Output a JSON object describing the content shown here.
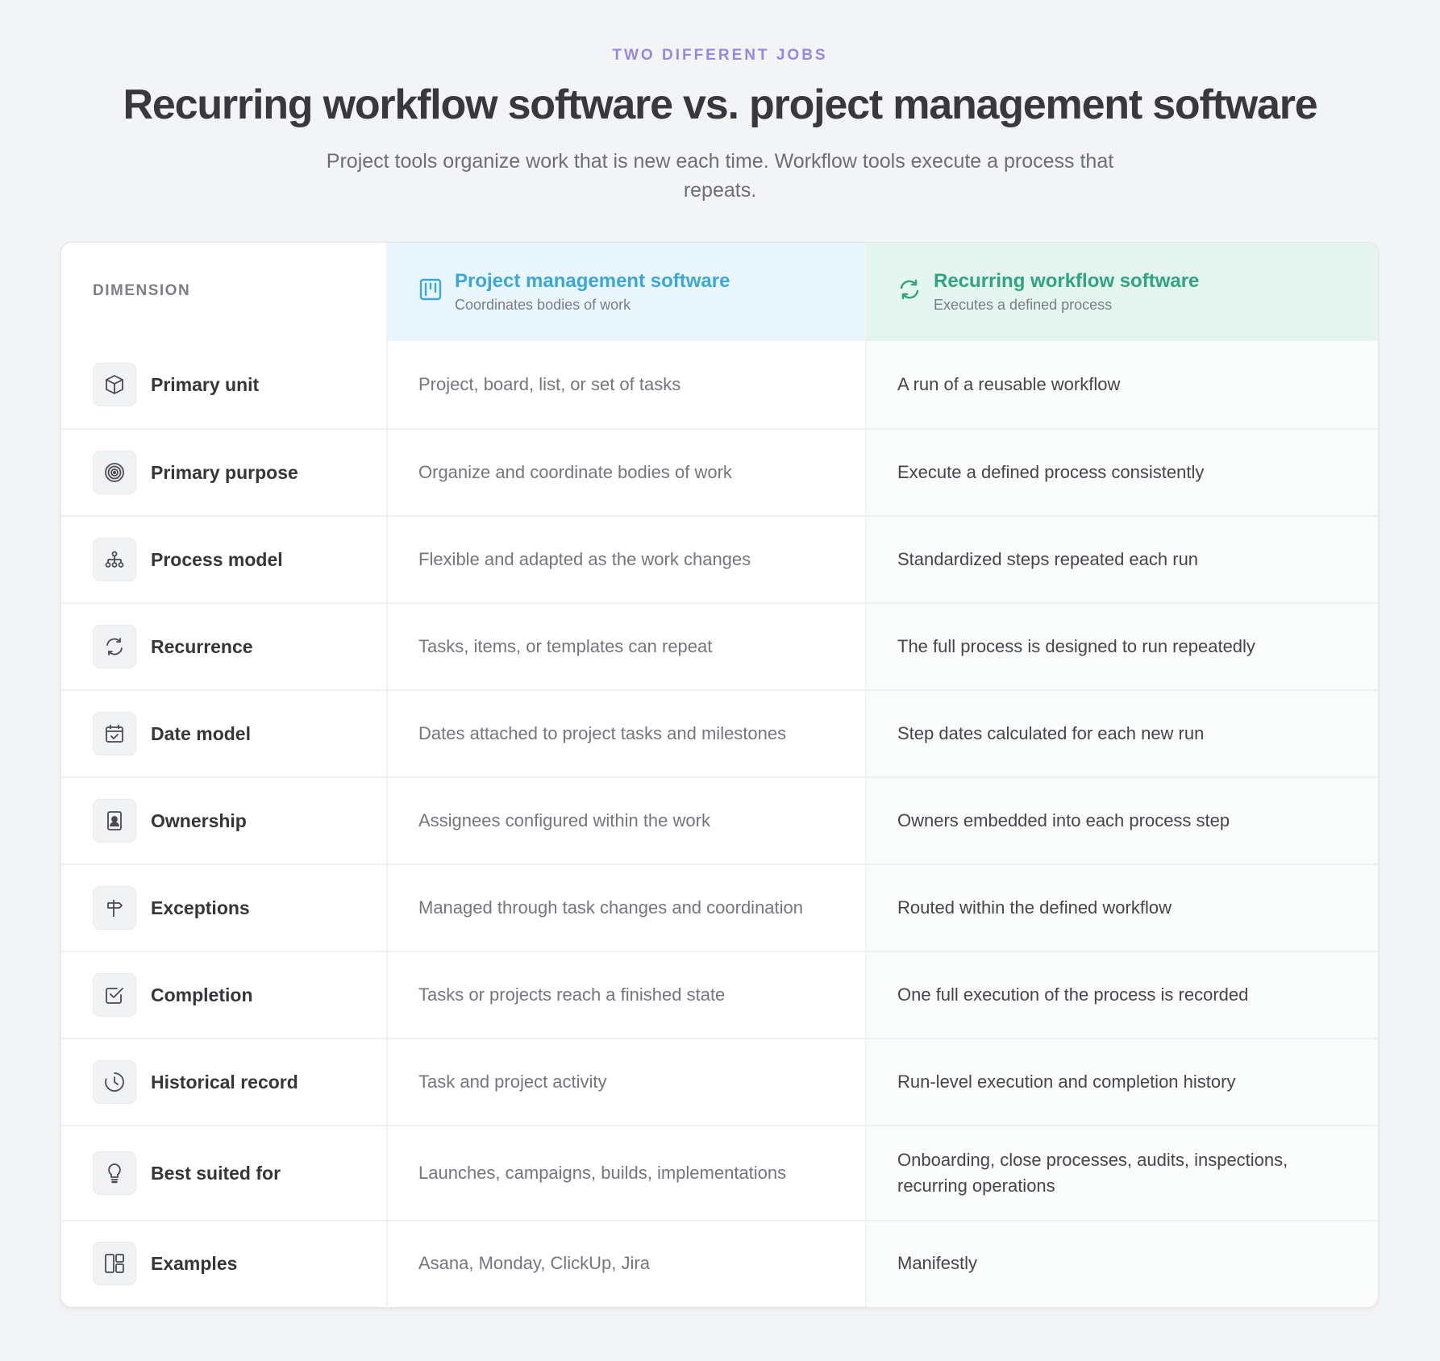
{
  "header": {
    "eyebrow": "TWO DIFFERENT JOBS",
    "title": "Recurring workflow software vs. project management software",
    "subtitle": "Project tools organize work that is new each time. Workflow tools execute a process that repeats."
  },
  "table": {
    "dimension_label": "DIMENSION",
    "columns": [
      {
        "title": "Project management software",
        "subtitle": "Coordinates bodies of work",
        "icon": "kanban-board-icon",
        "color": "#3aa7d6"
      },
      {
        "title": "Recurring workflow software",
        "subtitle": "Executes a defined process",
        "icon": "refresh-cycle-icon",
        "color": "#2fa382"
      }
    ],
    "rows": [
      {
        "dimension": "Primary unit",
        "icon": "cube-icon",
        "project": "Project, board, list, or set of tasks",
        "workflow": "A run of a reusable workflow"
      },
      {
        "dimension": "Primary purpose",
        "icon": "target-icon",
        "project": "Organize and coordinate bodies of work",
        "workflow": "Execute a defined process consistently"
      },
      {
        "dimension": "Process model",
        "icon": "hierarchy-icon",
        "project": "Flexible and adapted as the work changes",
        "workflow": "Standardized steps repeated each run"
      },
      {
        "dimension": "Recurrence",
        "icon": "refresh-icon",
        "project": "Tasks, items, or templates can repeat",
        "workflow": "The full process is designed to run repeatedly"
      },
      {
        "dimension": "Date model",
        "icon": "calendar-check-icon",
        "project": "Dates attached to project tasks and milestones",
        "workflow": "Step dates calculated for each new run"
      },
      {
        "dimension": "Ownership",
        "icon": "person-badge-icon",
        "project": "Assignees configured within the work",
        "workflow": "Owners embedded into each process step"
      },
      {
        "dimension": "Exceptions",
        "icon": "signpost-icon",
        "project": "Managed through task changes and coordination",
        "workflow": "Routed within the defined workflow"
      },
      {
        "dimension": "Completion",
        "icon": "checkbox-icon",
        "project": "Tasks or projects reach a finished state",
        "workflow": "One full execution of the process is recorded"
      },
      {
        "dimension": "Historical record",
        "icon": "clock-history-icon",
        "project": "Task and project activity",
        "workflow": "Run-level execution and completion history"
      },
      {
        "dimension": "Best suited for",
        "icon": "lightbulb-icon",
        "project": "Launches, campaigns, builds, implementations",
        "workflow": "Onboarding, close processes, audits, inspections, recurring operations"
      },
      {
        "dimension": "Examples",
        "icon": "layout-grid-icon",
        "project": "Asana, Monday, ClickUp, Jira",
        "workflow": "Manifestly"
      }
    ]
  }
}
